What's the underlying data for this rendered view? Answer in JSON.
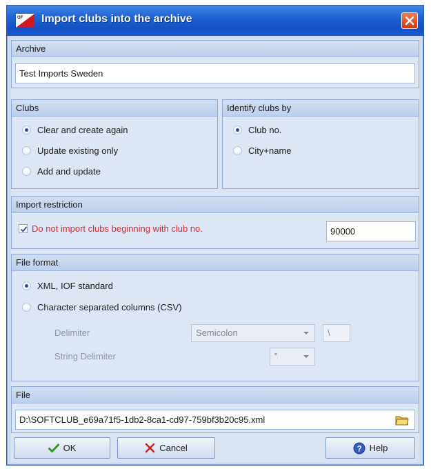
{
  "window": {
    "title": "Import clubs into the archive"
  },
  "archive": {
    "header": "Archive",
    "name": "Test Imports Sweden"
  },
  "clubs": {
    "header": "Clubs",
    "options": [
      "Clear and create again",
      "Update existing only",
      "Add and update"
    ],
    "selected": "Clear and create again"
  },
  "identify": {
    "header": "Identify clubs by",
    "options": [
      "Club no.",
      "City+name"
    ],
    "selected": "Club no."
  },
  "restriction": {
    "header": "Import restriction",
    "checkbox_label": "Do not import clubs beginning with club no.",
    "checked": true,
    "value": "90000"
  },
  "file_format": {
    "header": "File format",
    "options": [
      "XML, IOF standard",
      "Character separated columns (CSV)"
    ],
    "selected": "XML, IOF standard",
    "delimiter_label": "Delimiter",
    "delimiter_value": "Semicolon",
    "delimiter_custom": "\\",
    "string_delimiter_label": "String Delimiter",
    "string_delimiter_value": "\""
  },
  "file": {
    "header": "File",
    "path": "D:\\SOFTCLUB_e69a71f5-1db2-8ca1-cd97-759bf3b20c95.xml"
  },
  "buttons": {
    "ok": "OK",
    "cancel": "Cancel",
    "help": "Help"
  },
  "colors": {
    "title_bar": "#1f62d4",
    "restriction_text": "#e3242b",
    "ok_check": "#2f9a1a",
    "cancel_x": "#d81e1e"
  }
}
